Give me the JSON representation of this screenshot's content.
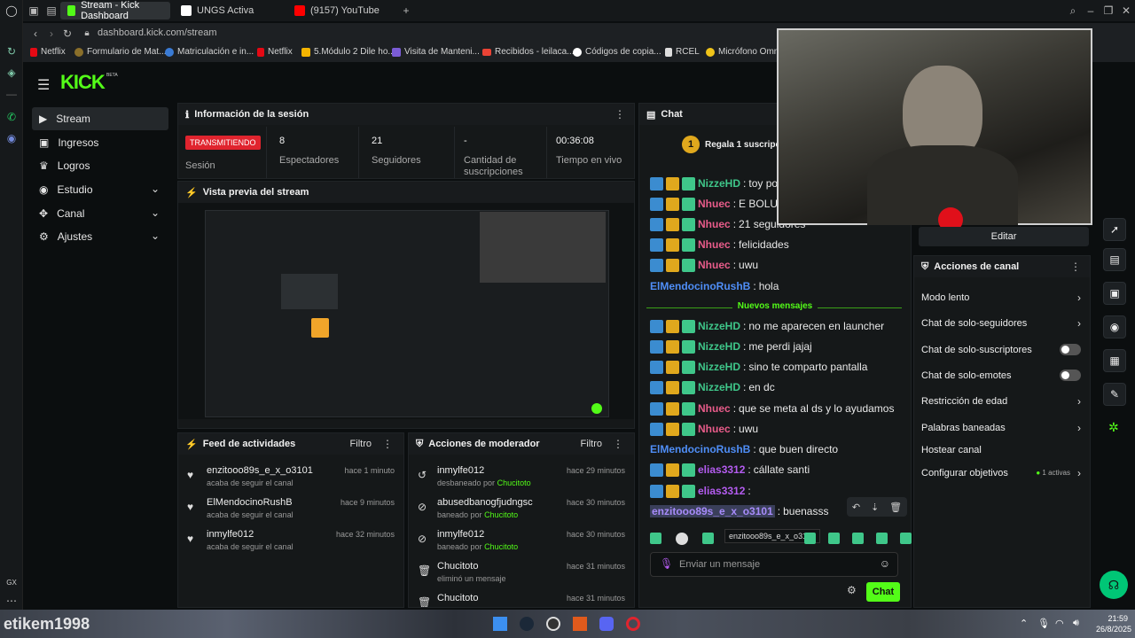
{
  "browser": {
    "tabs": [
      {
        "label": "Stream - Kick Dashboard",
        "color": "#53fc18"
      },
      {
        "label": "UNGS Activa",
        "color": "#ffffff"
      },
      {
        "label": "(9157) YouTube",
        "color": "#ff0000"
      }
    ],
    "url": "dashboard.kick.com/stream",
    "bookmarks": [
      "Netflix",
      "Formulario de Mat...",
      "Matriculación e in...",
      "Netflix",
      "5.Módulo 2 Dile ho...",
      "Visita de Manteni...",
      "Recibidos - leilaca...",
      "Códigos de copia...",
      "RCEL",
      "Micrófono Omni..."
    ]
  },
  "brand": {
    "logo": "KICK",
    "beta": "BETA",
    "accent": "#53fc18"
  },
  "sidebar": {
    "items": [
      {
        "label": "Stream",
        "icon": "play-icon"
      },
      {
        "label": "Ingresos",
        "icon": "money-icon"
      },
      {
        "label": "Logros",
        "icon": "trophy-icon"
      },
      {
        "label": "Estudio",
        "icon": "studio-icon"
      },
      {
        "label": "Canal",
        "icon": "channel-icon"
      },
      {
        "label": "Ajustes",
        "icon": "gear-icon"
      }
    ]
  },
  "session": {
    "title": "Información de la sesión",
    "live_badge": "TRANSMITIENDO",
    "live_label": "Sesión",
    "stats": [
      {
        "value": "8",
        "label": "Espectadores"
      },
      {
        "value": "21",
        "label": "Seguidores"
      },
      {
        "value": "-",
        "label": "Cantidad de suscripciones"
      },
      {
        "value": "00:36:08",
        "label": "Tiempo en vivo"
      }
    ]
  },
  "preview": {
    "title": "Vista previa del stream"
  },
  "activity": {
    "title": "Feed de actividades",
    "filter": "Filtro",
    "items": [
      {
        "name": "enzitooo89s_e_x_o3101",
        "sub": "acaba de seguir el canal",
        "time": "hace 1 minuto"
      },
      {
        "name": "ElMendocinoRushB",
        "sub": "acaba de seguir el canal",
        "time": "hace 9 minutos"
      },
      {
        "name": "inmylfe012",
        "sub": "acaba de seguir el canal",
        "time": "hace 32 minutos"
      }
    ]
  },
  "moderator": {
    "title": "Acciones de moderador",
    "filter": "Filtro",
    "items": [
      {
        "name": "inmylfe012",
        "action": "desbaneado por",
        "by": "Chucitoto",
        "time": "hace 29 minutos",
        "icon": "undo-icon"
      },
      {
        "name": "abusedbanogfjudngsc",
        "action": "baneado por",
        "by": "Chucitoto",
        "time": "hace 30 minutos",
        "icon": "ban-icon"
      },
      {
        "name": "inmylfe012",
        "action": "baneado por",
        "by": "Chucitoto",
        "time": "hace 30 minutos",
        "icon": "ban-icon"
      },
      {
        "name": "Chucitoto",
        "action": "eliminó un mensaje",
        "by": "",
        "time": "hace 31 minutos",
        "icon": "trash-icon"
      },
      {
        "name": "Chucitoto",
        "action": "",
        "by": "",
        "time": "hace 31 minutos",
        "icon": "trash-icon"
      }
    ]
  },
  "chat": {
    "title": "Chat",
    "gift_banner": "Regala 1 suscripción",
    "new_messages": "Nuevos mensajes",
    "messages": [
      {
        "user": "NizzeHD",
        "color": "#3fc78a",
        "text": "toy por",
        "badges": true
      },
      {
        "user": "Nhuec",
        "color": "#e85c8a",
        "text": "E BOLUDO",
        "badges": true
      },
      {
        "user": "Nhuec",
        "color": "#e85c8a",
        "text": "21 seguidores",
        "badges": true
      },
      {
        "user": "Nhuec",
        "color": "#e85c8a",
        "text": "felicidades",
        "badges": true
      },
      {
        "user": "Nhuec",
        "color": "#e85c8a",
        "text": "uwu",
        "badges": true
      },
      {
        "user": "ElMendocinoRushB",
        "color": "#4f8ef7",
        "text": "hola",
        "badges": false
      },
      {
        "user": "NizzeHD",
        "color": "#3fc78a",
        "text": "no me aparecen en launcher",
        "badges": true
      },
      {
        "user": "NizzeHD",
        "color": "#3fc78a",
        "text": "me perdi jajaj",
        "badges": true
      },
      {
        "user": "NizzeHD",
        "color": "#3fc78a",
        "text": "sino te comparto pantalla",
        "badges": true
      },
      {
        "user": "NizzeHD",
        "color": "#3fc78a",
        "text": "en dc",
        "badges": true
      },
      {
        "user": "Nhuec",
        "color": "#e85c8a",
        "text": "que se meta al ds y lo ayudamos",
        "badges": true
      },
      {
        "user": "Nhuec",
        "color": "#e85c8a",
        "text": "uwu",
        "badges": true
      },
      {
        "user": "ElMendocinoRushB",
        "color": "#4f8ef7",
        "text": "que buen directo",
        "badges": false
      },
      {
        "user": "elias3312",
        "color": "#b45cf0",
        "text": "cállate santi",
        "badges": true
      },
      {
        "user": "elias3312",
        "color": "#b45cf0",
        "text": "",
        "badges": true
      },
      {
        "user": "enzitooo89s_e_x_o3101",
        "color": "#a78bfa",
        "text": "buenasss",
        "badges": false
      }
    ],
    "tooltip": "enzitooo89s_e_x_o3101",
    "input_placeholder": "Enviar un mensaje",
    "send": "Chat"
  },
  "channel_actions": {
    "edit": "Editar",
    "title": "Acciones de canal",
    "items": [
      {
        "label": "Modo lento",
        "type": "chevron"
      },
      {
        "label": "Chat de solo-seguidores",
        "type": "chevron"
      },
      {
        "label": "Chat de solo-suscriptores",
        "type": "toggle"
      },
      {
        "label": "Chat de solo-emotes",
        "type": "toggle"
      },
      {
        "label": "Restricción de edad",
        "type": "chevron"
      },
      {
        "label": "Palabras baneadas",
        "type": "chevron"
      },
      {
        "label": "Hostear canal",
        "type": "none"
      },
      {
        "label": "Configurar objetivos",
        "type": "chevron",
        "extra": "1 activas"
      }
    ]
  },
  "taskbar": {
    "time": "21:59",
    "date": "26/8/2025",
    "watermark": "etikem1998"
  }
}
